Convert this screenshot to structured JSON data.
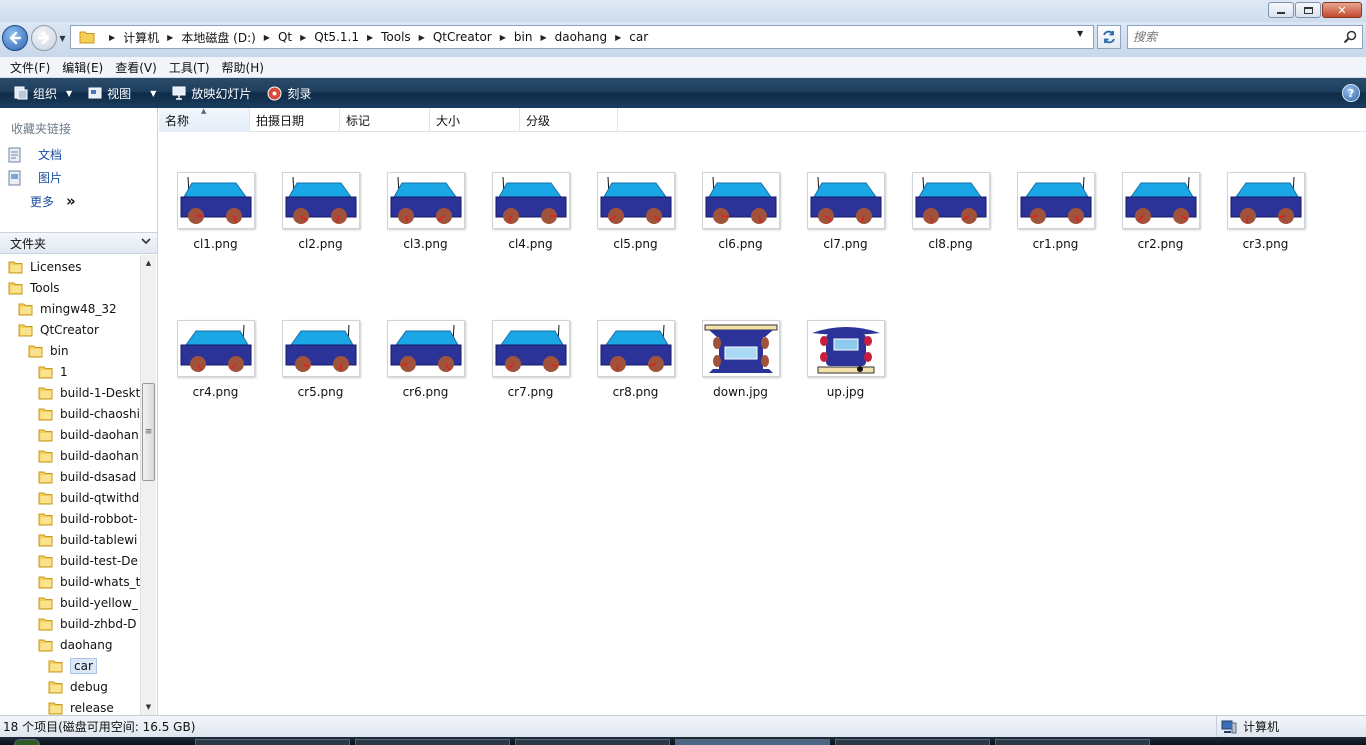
{
  "address": {
    "crumbs": [
      "计算机",
      "本地磁盘 (D:)",
      "Qt",
      "Qt5.1.1",
      "Tools",
      "QtCreator",
      "bin",
      "daohang",
      "car"
    ]
  },
  "search": {
    "placeholder": "搜索"
  },
  "menu": [
    "文件(F)",
    "编辑(E)",
    "查看(V)",
    "工具(T)",
    "帮助(H)"
  ],
  "commands": {
    "organize": "组织",
    "views": "视图",
    "slideshow": "放映幻灯片",
    "burn": "刻录"
  },
  "favorites": {
    "title": "收藏夹链接",
    "items": [
      {
        "label": "文档",
        "icon": "document-icon"
      },
      {
        "label": "图片",
        "icon": "pictures-icon"
      },
      {
        "label": "更多",
        "icon": "more-icon"
      }
    ],
    "more_glyph": "»"
  },
  "folders": {
    "title": "文件夹"
  },
  "tree": [
    {
      "label": "Licenses",
      "level": 0
    },
    {
      "label": "Tools",
      "level": 0
    },
    {
      "label": "mingw48_32",
      "level": 1
    },
    {
      "label": "QtCreator",
      "level": 1
    },
    {
      "label": "bin",
      "level": 2
    },
    {
      "label": "1",
      "level": 3
    },
    {
      "label": "build-1-Deskt",
      "level": 3
    },
    {
      "label": "build-chaoshi",
      "level": 3
    },
    {
      "label": "build-daohan",
      "level": 3
    },
    {
      "label": "build-daohan",
      "level": 3
    },
    {
      "label": "build-dsasad",
      "level": 3
    },
    {
      "label": "build-qtwithd",
      "level": 3
    },
    {
      "label": "build-robbot-",
      "level": 3
    },
    {
      "label": "build-tablewi",
      "level": 3
    },
    {
      "label": "build-test-De",
      "level": 3
    },
    {
      "label": "build-whats_t",
      "level": 3
    },
    {
      "label": "build-yellow_",
      "level": 3
    },
    {
      "label": "build-zhbd-D",
      "level": 3
    },
    {
      "label": "daohang",
      "level": 3
    },
    {
      "label": "car",
      "level": 4,
      "selected": true
    },
    {
      "label": "debug",
      "level": 4
    },
    {
      "label": "release",
      "level": 4
    }
  ],
  "columns": [
    "名称",
    "拍摄日期",
    "标记",
    "大小",
    "分级"
  ],
  "files": [
    {
      "name": "cl1.png",
      "kind": "left"
    },
    {
      "name": "cl2.png",
      "kind": "left"
    },
    {
      "name": "cl3.png",
      "kind": "left"
    },
    {
      "name": "cl4.png",
      "kind": "left"
    },
    {
      "name": "cl5.png",
      "kind": "left"
    },
    {
      "name": "cl6.png",
      "kind": "left"
    },
    {
      "name": "cl7.png",
      "kind": "left"
    },
    {
      "name": "cl8.png",
      "kind": "left"
    },
    {
      "name": "cr1.png",
      "kind": "right"
    },
    {
      "name": "cr2.png",
      "kind": "right"
    },
    {
      "name": "cr3.png",
      "kind": "right"
    },
    {
      "name": "cr4.png",
      "kind": "right"
    },
    {
      "name": "cr5.png",
      "kind": "right"
    },
    {
      "name": "cr6.png",
      "kind": "right"
    },
    {
      "name": "cr7.png",
      "kind": "right"
    },
    {
      "name": "cr8.png",
      "kind": "right"
    },
    {
      "name": "down.jpg",
      "kind": "down"
    },
    {
      "name": "up.jpg",
      "kind": "up"
    }
  ],
  "status": {
    "left": "18 个项目(磁盘可用空间: 16.5 GB)",
    "right": "计算机"
  },
  "colors": {
    "car_body": "#2b3399",
    "car_window": "#1ba6e6",
    "car_wheel": "#a0523a",
    "car_spoke": "#e02020",
    "cmdbar": "#1e3e5d"
  }
}
